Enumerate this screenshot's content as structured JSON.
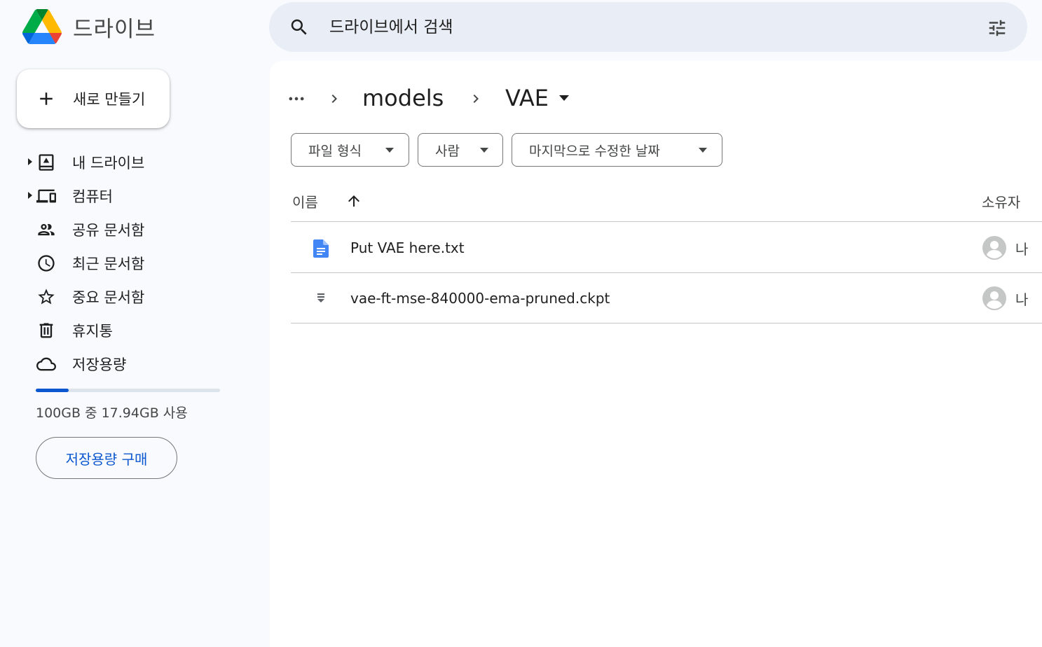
{
  "app": {
    "title": "드라이브"
  },
  "search": {
    "placeholder": "드라이브에서 검색"
  },
  "sidebar": {
    "new_label": "새로 만들기",
    "items": [
      {
        "label": "내 드라이브",
        "icon": "my-drive-icon"
      },
      {
        "label": "컴퓨터",
        "icon": "computers-icon"
      },
      {
        "label": "공유 문서함",
        "icon": "shared-icon"
      },
      {
        "label": "최근 문서함",
        "icon": "recent-icon"
      },
      {
        "label": "중요 문서함",
        "icon": "star-icon"
      },
      {
        "label": "휴지통",
        "icon": "trash-icon"
      },
      {
        "label": "저장용량",
        "icon": "cloud-icon"
      }
    ],
    "storage": {
      "text": "100GB 중 17.94GB 사용",
      "used_fraction": 0.1794
    },
    "buy_label": "저장용량 구매"
  },
  "breadcrumb": {
    "parent": "models",
    "current": "VAE"
  },
  "filters": [
    {
      "label": "파일 형식"
    },
    {
      "label": "사람"
    },
    {
      "label": "마지막으로 수정한 날짜"
    }
  ],
  "table": {
    "col_name": "이름",
    "col_owner": "소유자",
    "rows": [
      {
        "name": "Put VAE here.txt",
        "owner": "나",
        "icon": "document-icon"
      },
      {
        "name": "vae-ft-mse-840000-ema-pruned.ckpt",
        "owner": "나",
        "icon": "binary-file-icon"
      }
    ]
  },
  "colors": {
    "accent": "#0b57d0",
    "background": "#f8fafd",
    "search_bg": "#e9eef6",
    "doc_blue": "#4285f4"
  }
}
